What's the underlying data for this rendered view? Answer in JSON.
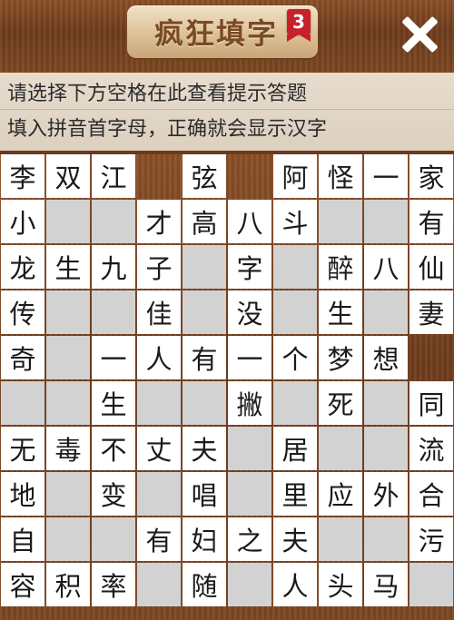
{
  "header": {
    "title": "疯狂填字",
    "level": "3",
    "close_icon": "close-icon"
  },
  "hints": {
    "line1": "请选择下方空格在此查看提示答题",
    "line2": "填入拼音首字母，正确就会显示汉字"
  },
  "colors": {
    "wood": "#7a4522",
    "hint_bg": "#e4d9ca",
    "cell_filled": "#ffffff",
    "cell_empty": "#d2d2d2",
    "badge": "#c8202a"
  },
  "grid": [
    [
      "李",
      "双",
      "江",
      "#",
      "弦",
      "#",
      "阿",
      "怪",
      "一",
      "家"
    ],
    [
      "小",
      "_",
      "_",
      "才",
      "高",
      "八",
      "斗",
      "_",
      "_",
      "有"
    ],
    [
      "龙",
      "生",
      "九",
      "子",
      "_",
      "字",
      "_",
      "醉",
      "八",
      "仙"
    ],
    [
      "传",
      "_",
      "_",
      "佳",
      "_",
      "没",
      "_",
      "生",
      "_",
      "妻"
    ],
    [
      "奇",
      "_",
      "一",
      "人",
      "有",
      "一",
      "个",
      "梦",
      "想",
      "#"
    ],
    [
      "_",
      "_",
      "生",
      "_",
      "_",
      "撇",
      "_",
      "死",
      "_",
      "同"
    ],
    [
      "无",
      "毒",
      "不",
      "丈",
      "夫",
      "_",
      "居",
      "_",
      "_",
      "流"
    ],
    [
      "地",
      "_",
      "变",
      "_",
      "唱",
      "_",
      "里",
      "应",
      "外",
      "合"
    ],
    [
      "自",
      "_",
      "_",
      "有",
      "妇",
      "之",
      "夫",
      "_",
      "_",
      "污"
    ],
    [
      "容",
      "积",
      "率",
      "_",
      "随",
      "_",
      "人",
      "头",
      "马",
      "_"
    ]
  ]
}
